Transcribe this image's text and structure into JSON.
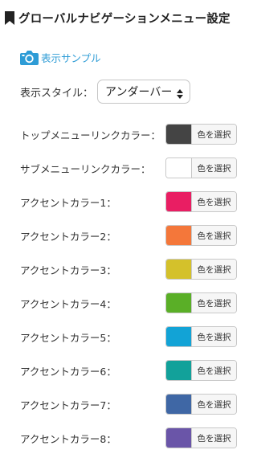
{
  "header": {
    "title": "グローバルナビゲーションメニュー設定",
    "icon": "bookmark-icon"
  },
  "sample": {
    "icon": "camera-icon",
    "label": "表示サンプル",
    "color": "#2e9cd6"
  },
  "display_style": {
    "label": "表示スタイル：",
    "selected": "アンダーバー"
  },
  "colors": [
    {
      "label": "トップメニューリンクカラー：",
      "value": "#444444",
      "button": "色を選択"
    },
    {
      "label": "サブメニューリンクカラー：",
      "value": "#ffffff",
      "button": "色を選択"
    },
    {
      "label": "アクセントカラー1：",
      "value": "#e91e63",
      "button": "色を選択"
    },
    {
      "label": "アクセントカラー2：",
      "value": "#f4773a",
      "button": "色を選択"
    },
    {
      "label": "アクセントカラー3：",
      "value": "#d4c12b",
      "button": "色を選択"
    },
    {
      "label": "アクセントカラー4：",
      "value": "#5aaf27",
      "button": "色を選択"
    },
    {
      "label": "アクセントカラー5：",
      "value": "#12a3d6",
      "button": "色を選択"
    },
    {
      "label": "アクセントカラー6：",
      "value": "#12a19a",
      "button": "色を選択"
    },
    {
      "label": "アクセントカラー7：",
      "value": "#3f67a5",
      "button": "色を選択"
    },
    {
      "label": "アクセントカラー8：",
      "value": "#6a55a8",
      "button": "色を選択"
    }
  ]
}
